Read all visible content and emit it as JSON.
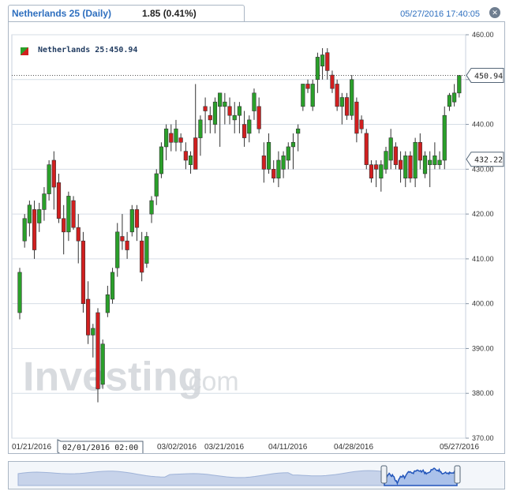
{
  "header": {
    "title": "Netherlands 25 (Daily)",
    "change": "1.85 (0.41%)",
    "datetime": "05/27/2016 17:40:05",
    "close_icon": "close-icon"
  },
  "legend": {
    "text": "Netherlands 25:450.94"
  },
  "watermark": {
    "logo_text": "Investing",
    "logo_suffix": ".com"
  },
  "colors": {
    "up": "#2aa02a",
    "down": "#d11f1f",
    "accent": "#2e6fbf",
    "grid": "#d6dde6",
    "nav_line": "#2255bb"
  },
  "chart_data": {
    "type": "candlestick",
    "ylim": [
      370,
      460
    ],
    "y_ticks": [
      "370.00",
      "380.00",
      "390.00",
      "400.00",
      "410.00",
      "420.00",
      "430.00",
      "440.00",
      "450.00",
      "460.00"
    ],
    "x_tick_labels": [
      "01/21/2016",
      "03/02/2016",
      "03/21/2016",
      "04/11/2016",
      "04/28/2016",
      "05/27/2016"
    ],
    "crosshair_label": "02/01/2016 02:00",
    "current_price_label": "450.94",
    "current_price": 450.94,
    "marker_label": "432.22",
    "marker_price": 432.22,
    "candles": [
      [
        398.0,
        408.0,
        396.5,
        407.0
      ],
      [
        414.0,
        420.0,
        412.5,
        419.0
      ],
      [
        418.0,
        423.0,
        415.0,
        422.0
      ],
      [
        421.0,
        423.0,
        410.0,
        412.0
      ],
      [
        418.0,
        422.5,
        416.0,
        421.0
      ],
      [
        421.0,
        426.0,
        418.5,
        424.5
      ],
      [
        424.5,
        432.0,
        423.0,
        431.0
      ],
      [
        432.0,
        434.0,
        421.0,
        426.0
      ],
      [
        427.0,
        429.0,
        418.0,
        419.0
      ],
      [
        419.0,
        422.0,
        411.0,
        416.0
      ],
      [
        416.0,
        425.0,
        414.0,
        424.0
      ],
      [
        423.0,
        424.0,
        416.5,
        417.0
      ],
      [
        417.0,
        420.0,
        409.0,
        414.0
      ],
      [
        414.0,
        416.0,
        398.0,
        400.0
      ],
      [
        401.0,
        405.0,
        391.0,
        393.0
      ],
      [
        393.0,
        395.5,
        388.0,
        394.5
      ],
      [
        398.0,
        399.0,
        378.0,
        381.0
      ],
      [
        382.0,
        392.0,
        381.0,
        391.0
      ],
      [
        398.0,
        404.0,
        397.0,
        402.0
      ],
      [
        401.0,
        408.0,
        400.0,
        407.0
      ],
      [
        408.0,
        418.0,
        406.0,
        416.0
      ],
      [
        415.0,
        420.0,
        412.0,
        414.0
      ],
      [
        414.0,
        416.0,
        410.0,
        412.0
      ],
      [
        416.0,
        422.0,
        415.0,
        421.0
      ],
      [
        421.0,
        422.0,
        414.0,
        417.0
      ],
      [
        414.0,
        416.0,
        405.0,
        407.0
      ],
      [
        409.0,
        416.0,
        408.0,
        415.0
      ],
      [
        420.0,
        424.0,
        418.0,
        423.0
      ],
      [
        424.0,
        430.0,
        422.0,
        429.0
      ],
      [
        429.0,
        436.0,
        428.0,
        435.0
      ],
      [
        435.0,
        440.0,
        432.0,
        439.0
      ],
      [
        438.0,
        440.0,
        434.0,
        436.0
      ],
      [
        436.0,
        441.0,
        434.0,
        439.0
      ],
      [
        437.0,
        438.0,
        434.0,
        436.0
      ],
      [
        434.0,
        436.0,
        430.0,
        432.0
      ],
      [
        431.0,
        434.0,
        429.0,
        433.0
      ],
      [
        437.0,
        449.0,
        430.0,
        430.0
      ],
      [
        437.0,
        442.0,
        433.0,
        441.0
      ],
      [
        444.0,
        446.0,
        438.0,
        443.0
      ],
      [
        442.0,
        444.0,
        438.0,
        441.0
      ],
      [
        440.0,
        446.0,
        438.0,
        445.0
      ],
      [
        444.0,
        447.0,
        435.0,
        447.0
      ],
      [
        444.0,
        447.0,
        440.0,
        445.0
      ],
      [
        444.0,
        446.0,
        440.0,
        442.0
      ],
      [
        441.0,
        445.0,
        438.0,
        442.0
      ],
      [
        442.0,
        445.0,
        438.0,
        444.0
      ],
      [
        440.0,
        443.0,
        435.0,
        437.0
      ],
      [
        438.0,
        442.0,
        436.0,
        441.0
      ],
      [
        443.0,
        448.0,
        441.0,
        447.0
      ],
      [
        444.0,
        446.0,
        438.0,
        439.0
      ],
      [
        433.0,
        436.0,
        427.0,
        430.0
      ],
      [
        430.0,
        438.0,
        429.0,
        436.0
      ],
      [
        430.0,
        432.0,
        427.0,
        428.0
      ],
      [
        428.0,
        434.0,
        426.0,
        432.0
      ],
      [
        430.0,
        434.0,
        428.0,
        433.0
      ],
      [
        432.0,
        436.0,
        430.0,
        435.0
      ],
      [
        435.0,
        438.0,
        430.0,
        436.0
      ],
      [
        438.0,
        440.0,
        434.0,
        439.0
      ],
      [
        444.0,
        449.0,
        443.0,
        449.0
      ],
      [
        449.0,
        450.0,
        447.0,
        448.0
      ],
      [
        444.0,
        450.0,
        443.0,
        449.0
      ],
      [
        450.0,
        456.0,
        447.0,
        455.0
      ],
      [
        453.0,
        457.0,
        450.0,
        455.5
      ],
      [
        456.0,
        457.0,
        450.0,
        452.0
      ],
      [
        451.0,
        452.0,
        447.0,
        448.0
      ],
      [
        449.0,
        450.0,
        443.0,
        444.0
      ],
      [
        444.0,
        447.0,
        440.0,
        446.0
      ],
      [
        446.0,
        447.0,
        441.0,
        442.0
      ],
      [
        442.0,
        451.0,
        441.0,
        450.0
      ],
      [
        445.0,
        446.0,
        436.0,
        438.0
      ],
      [
        441.0,
        442.0,
        438.0,
        439.0
      ],
      [
        438.0,
        439.0,
        430.0,
        431.0
      ],
      [
        431.0,
        432.0,
        427.0,
        428.0
      ],
      [
        431.0,
        432.0,
        426.0,
        430.0
      ],
      [
        428.0,
        432.0,
        425.0,
        431.0
      ],
      [
        430.0,
        435.0,
        429.0,
        434.0
      ],
      [
        432.0,
        439.0,
        430.0,
        437.0
      ],
      [
        435.0,
        436.0,
        430.0,
        431.0
      ],
      [
        432.0,
        434.0,
        427.0,
        430.0
      ],
      [
        428.0,
        434.0,
        426.0,
        433.0
      ],
      [
        433.0,
        434.0,
        427.0,
        428.0
      ],
      [
        428.0,
        437.0,
        426.0,
        436.0
      ],
      [
        436.0,
        438.0,
        430.0,
        432.0
      ],
      [
        429.0,
        434.0,
        428.0,
        433.0
      ],
      [
        431.0,
        434.0,
        426.0,
        432.0
      ],
      [
        431.0,
        436.0,
        430.0,
        433.0
      ],
      [
        431.0,
        434.0,
        430.0,
        432.0
      ],
      [
        432.0,
        444.0,
        430.0,
        442.0
      ],
      [
        444.0,
        447.0,
        443.0,
        446.5
      ],
      [
        445.0,
        449.0,
        444.0,
        447.0
      ],
      [
        447.0,
        451.0,
        446.0,
        450.9
      ]
    ]
  },
  "navigator": {
    "handle_icon": "drag-handle-icon"
  }
}
